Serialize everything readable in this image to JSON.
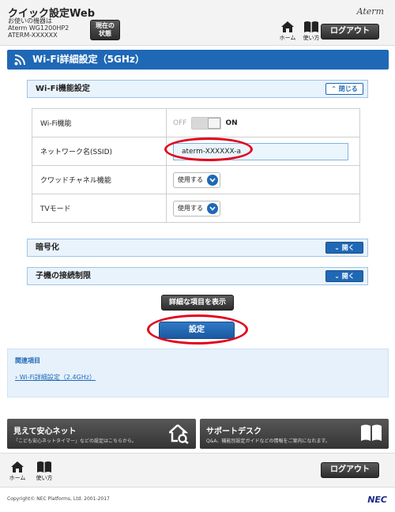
{
  "header": {
    "title": "クイック設定Web",
    "device_line1": "お使いの機器は",
    "device_line2": "Aterm WG1200HP2",
    "device_line3": "ATERM-XXXXXX",
    "status_button_line1": "現在の",
    "status_button_line2": "状態",
    "brand": "Aterm",
    "home_label": "ホーム",
    "help_label": "使い方",
    "logout_label": "ログアウト"
  },
  "page": {
    "title": "Wi-Fi詳細設定（5GHz）"
  },
  "sections": {
    "wifi_function": {
      "label": "Wi-Fi機能設定",
      "toggle": "閉じる"
    },
    "encryption": {
      "label": "暗号化",
      "toggle": "開く"
    },
    "access_limit": {
      "label": "子機の接続制限",
      "toggle": "開く"
    }
  },
  "settings": {
    "wifi_label": "Wi-Fi機能",
    "switch_off": "OFF",
    "switch_on": "ON",
    "switch_state": "on",
    "ssid_label": "ネットワーク名(SSID)",
    "ssid_value": "aterm-XXXXXX-a",
    "quad_label": "クワッドチャネル機能",
    "quad_value": "使用する",
    "tv_label": "TVモード",
    "tv_value": "使用する"
  },
  "actions": {
    "show_details": "詳細な項目を表示",
    "save": "設定"
  },
  "related": {
    "heading": "関連項目",
    "link": "Wi-Fi詳細設定（2.4GHz）"
  },
  "cards": {
    "left_title": "見えて安心ネット",
    "left_sub": "「こども安心ネットタイマー」などの設定はこちらから。",
    "right_title": "サポートデスク",
    "right_sub": "Q&A、機能別設定ガイドなどの情報をご案内になれます。"
  },
  "footer": {
    "home_label": "ホーム",
    "help_label": "使い方",
    "logout_label": "ログアウト",
    "copyright": "Copyright© NEC Platforms, Ltd. 2001-2017",
    "logo": "NEC"
  },
  "colors": {
    "accent_blue": "#1f68b6",
    "highlight_red": "#e3001b",
    "dark_button": "#3a3a3a"
  },
  "icons": [
    "wifi-icon",
    "home-icon",
    "book-icon",
    "chevron-up-icon",
    "chevron-down-icon",
    "house-search-icon"
  ]
}
